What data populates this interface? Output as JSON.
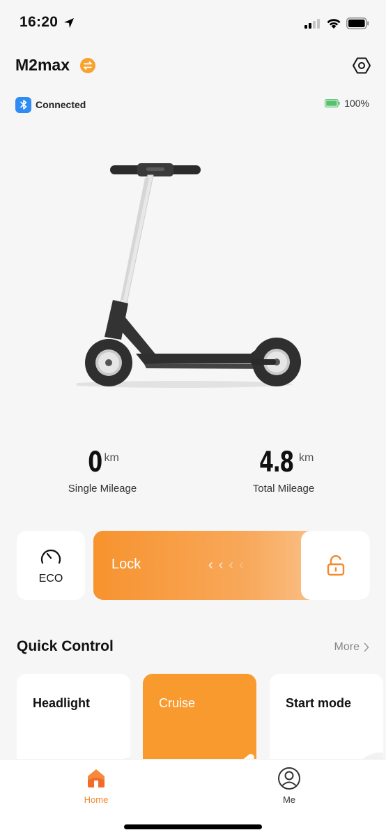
{
  "status_bar": {
    "time": "16:20",
    "location_icon": "location-arrow-icon",
    "signal_icon": "cellular-signal-icon",
    "wifi_icon": "wifi-icon",
    "battery_icon": "battery-icon"
  },
  "header": {
    "device_name": "M2max",
    "switch_icon": "switch-device-icon",
    "settings_icon": "hexagon-settings-icon"
  },
  "connection": {
    "status": "Connected",
    "icon": "bluetooth-icon",
    "battery_level": "100%",
    "battery_color": "#57c26d"
  },
  "mileage": {
    "single": {
      "value": "0",
      "unit": "km",
      "label": "Single Mileage"
    },
    "total": {
      "value": "4.8",
      "unit": "km",
      "label": "Total Mileage"
    }
  },
  "mode": {
    "label": "ECO",
    "icon": "speedometer-icon"
  },
  "lock": {
    "label": "Lock",
    "icon": "unlock-icon",
    "chevron": "‹"
  },
  "quick_control": {
    "title": "Quick Control",
    "more_label": "More",
    "cards": [
      {
        "label": "Headlight",
        "active": false
      },
      {
        "label": "Cruise",
        "active": true
      },
      {
        "label": "Start mode",
        "active": false
      }
    ]
  },
  "nav": {
    "home_label": "Home",
    "me_label": "Me",
    "active": "home"
  },
  "colors": {
    "accent": "#f7932e",
    "bluetooth": "#2f8cf3",
    "background": "#f6f6f6"
  }
}
